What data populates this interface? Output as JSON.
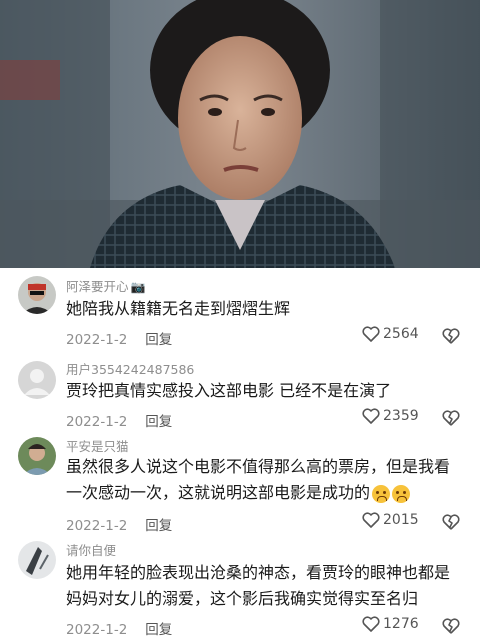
{
  "comments": [
    {
      "username": "阿泽要开心",
      "username_suffix_icon": "camera-emoji",
      "lines": [
        "她陪我从籍籍无名走到熠熠生辉"
      ],
      "date": "2022-1-2",
      "reply_label": "回复",
      "likes": "2564"
    },
    {
      "username": "用户3554242487586",
      "lines": [
        "贾玲把真情实感投入这部电影 已经不是在演了"
      ],
      "date": "2022-1-2",
      "reply_label": "回复",
      "likes": "2359"
    },
    {
      "username": "平安是只猫",
      "lines": [
        "虽然很多人说这个电影不值得那么高的票房，但是我看",
        "一次感动一次，这就说明这部电影是成功的"
      ],
      "trailing_emoji": "crying-face-emoji",
      "date": "2022-1-2",
      "reply_label": "回复",
      "likes": "2015"
    },
    {
      "username": "请你自便",
      "lines": [
        "她用年轻的脸表现出沧桑的神态，看贾玲的眼神也都是",
        "妈妈对女儿的溺爱，这个影后我确实觉得实至名归"
      ],
      "date": "2022-1-2",
      "reply_label": "回复",
      "likes": "1276"
    }
  ],
  "colors": {
    "text": "#1a1a1a",
    "meta": "#8e8e8e",
    "icon": "#555555"
  }
}
